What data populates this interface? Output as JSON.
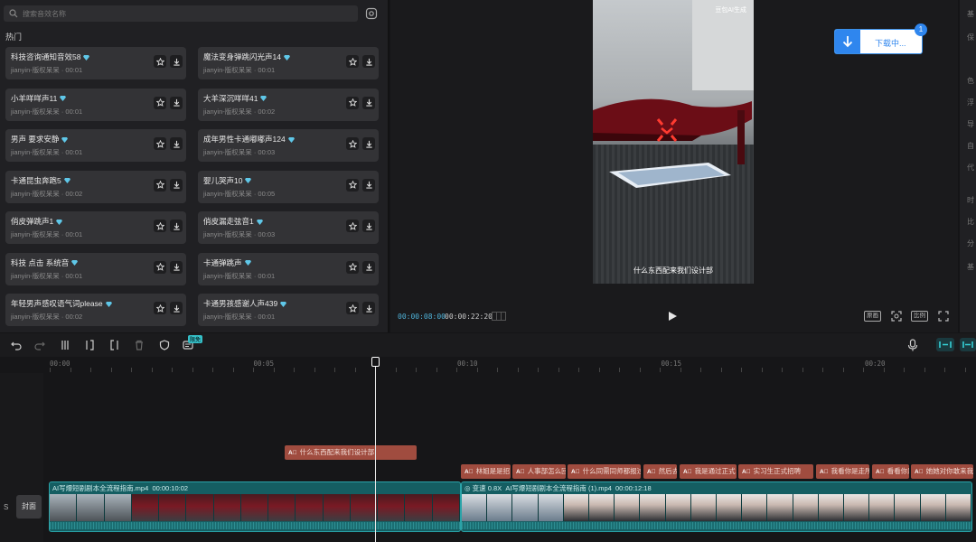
{
  "library": {
    "search_placeholder": "搜索音效名称",
    "section_title": "热门",
    "items": [
      {
        "title": "科技咨询通知音效58",
        "sub": "jianyin-版权呆呆 · 00:01"
      },
      {
        "title": "魔法变身弹跳闪光声14",
        "sub": "jianyin-版权呆呆 · 00:01"
      },
      {
        "title": "小羊咩咩声11",
        "sub": "jianyin-版权呆呆 · 00:01"
      },
      {
        "title": "大羊深沉咩咩41",
        "sub": "jianyin-版权呆呆 · 00:02"
      },
      {
        "title": "男声 要求安静",
        "sub": "jianyin-版权呆呆 · 00:01"
      },
      {
        "title": "成年男性卡通嘟嘟声124",
        "sub": "jianyin-版权呆呆 · 00:03"
      },
      {
        "title": "卡通昆虫奔跑5",
        "sub": "jianyin-版权呆呆 · 00:02"
      },
      {
        "title": "婴儿哭声10",
        "sub": "jianyin-版权呆呆 · 00:05"
      },
      {
        "title": "俏皮弹跳声1",
        "sub": "jianyin-版权呆呆 · 00:01"
      },
      {
        "title": "俏皮漏走弦音1",
        "sub": "jianyin-版权呆呆 · 00:03"
      },
      {
        "title": "科技 点击 系统音",
        "sub": "jianyin-版权呆呆 · 00:01"
      },
      {
        "title": "卡通弹跳声",
        "sub": "jianyin-版权呆呆 · 00:01"
      },
      {
        "title": "年轻男声感叹语气词please",
        "sub": "jianyin-版权呆呆 · 00:02"
      },
      {
        "title": "卡通男孩感谢人声439",
        "sub": "jianyin-版权呆呆 · 00:01"
      }
    ]
  },
  "preview": {
    "watermark": "豆包AI生成",
    "subtitle": "什么东西配来我们设计部",
    "current_time": "00:00:08:00",
    "total_time": "00:00:22:20",
    "btn_original": "原画",
    "btn_ratio": "比例",
    "download_text": "下载中...",
    "download_count": "1"
  },
  "right_strip": [
    "基",
    "保",
    "色",
    "浮",
    "导",
    "自",
    "代",
    "时",
    "比",
    "分",
    "基"
  ],
  "toolbar": {
    "free_badge": "限免"
  },
  "ruler": [
    "00:00",
    "00:05",
    "00:10",
    "00:15",
    "00:20"
  ],
  "timeline": {
    "side_label": "S",
    "cover_label": "封面",
    "subtitle_main": "什么东西配来我们设计部",
    "subtitle_clips": [
      "林姐是是招",
      "人事部怎么回",
      "什么同需同师都报过",
      "然后去",
      "我是通过正式",
      "实习生正式招聘",
      "我看你是走所",
      "看看你是",
      "她她对你敢来我"
    ],
    "clip1_label": "AI写爆短剧剧本全流程指南.mp4",
    "clip1_dur": "00:00:10:02",
    "clip2_speed": "变速 0.8X",
    "clip2_label": "AI写爆短剧剧本全流程指南 (1).mp4",
    "clip2_dur": "00:00:12:18"
  },
  "colors": {
    "accent": "#2f86ee",
    "teal": "#155e62",
    "subtitle_clip": "#a04c3f",
    "timecode": "#4fb3d9"
  }
}
